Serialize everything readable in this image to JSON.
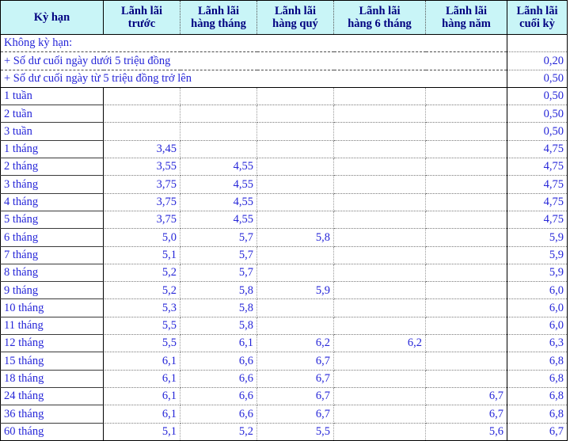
{
  "table": {
    "headers": [
      {
        "id": "term",
        "label": "Kỳ hạn",
        "name": "column-header-term"
      },
      {
        "id": "truoc",
        "label": "Lãnh lãi\ntrước",
        "name": "column-header-lanh-lai-truoc"
      },
      {
        "id": "thang",
        "label": "Lãnh lãi\nhàng tháng",
        "name": "column-header-lanh-lai-hang-thang"
      },
      {
        "id": "quy",
        "label": "Lãnh lãi\nhàng quý",
        "name": "column-header-lanh-lai-hang-quy"
      },
      {
        "id": "sau",
        "label": "Lãnh lãi\nhàng 6 tháng",
        "name": "column-header-lanh-lai-hang-6-thang"
      },
      {
        "id": "nam",
        "label": "Lãnh lãi\nhàng năm",
        "name": "column-header-lanh-lai-hang-nam"
      },
      {
        "id": "cuoi",
        "label": "Lãnh lãi\ncuối kỳ",
        "name": "column-header-lanh-lai-cuoi-ky"
      }
    ],
    "group_rows": [
      {
        "label": "Không kỳ hạn:",
        "cuoi": ""
      },
      {
        "label": "+ Số dư cuối ngày dưới 5 triệu đồng",
        "cuoi": "0,20"
      },
      {
        "label": "+ Số dư cuối ngày từ 5 triệu đồng trở lên",
        "cuoi": "0,50"
      }
    ],
    "rows": [
      {
        "term": "1 tuần",
        "truoc": "",
        "thang": "",
        "quy": "",
        "sau": "",
        "nam": "",
        "cuoi": "0,50"
      },
      {
        "term": "2 tuần",
        "truoc": "",
        "thang": "",
        "quy": "",
        "sau": "",
        "nam": "",
        "cuoi": "0,50"
      },
      {
        "term": "3 tuần",
        "truoc": "",
        "thang": "",
        "quy": "",
        "sau": "",
        "nam": "",
        "cuoi": "0,50"
      },
      {
        "term": "1 tháng",
        "truoc": "3,45",
        "thang": "",
        "quy": "",
        "sau": "",
        "nam": "",
        "cuoi": "4,75"
      },
      {
        "term": "2 tháng",
        "truoc": "3,55",
        "thang": "4,55",
        "quy": "",
        "sau": "",
        "nam": "",
        "cuoi": "4,75"
      },
      {
        "term": "3 tháng",
        "truoc": "3,75",
        "thang": "4,55",
        "quy": "",
        "sau": "",
        "nam": "",
        "cuoi": "4,75"
      },
      {
        "term": "4 tháng",
        "truoc": "3,75",
        "thang": "4,55",
        "quy": "",
        "sau": "",
        "nam": "",
        "cuoi": "4,75"
      },
      {
        "term": "5 tháng",
        "truoc": "3,75",
        "thang": "4,55",
        "quy": "",
        "sau": "",
        "nam": "",
        "cuoi": "4,75"
      },
      {
        "term": "6 tháng",
        "truoc": "5,0",
        "thang": "5,7",
        "quy": "5,8",
        "sau": "",
        "nam": "",
        "cuoi": "5,9"
      },
      {
        "term": "7 tháng",
        "truoc": "5,1",
        "thang": "5,7",
        "quy": "",
        "sau": "",
        "nam": "",
        "cuoi": "5,9"
      },
      {
        "term": "8 tháng",
        "truoc": "5,2",
        "thang": "5,7",
        "quy": "",
        "sau": "",
        "nam": "",
        "cuoi": "5,9"
      },
      {
        "term": "9 tháng",
        "truoc": "5,2",
        "thang": "5,8",
        "quy": "5,9",
        "sau": "",
        "nam": "",
        "cuoi": "6,0"
      },
      {
        "term": "10 tháng",
        "truoc": "5,3",
        "thang": "5,8",
        "quy": "",
        "sau": "",
        "nam": "",
        "cuoi": "6,0"
      },
      {
        "term": "11 tháng",
        "truoc": "5,5",
        "thang": "5,8",
        "quy": "",
        "sau": "",
        "nam": "",
        "cuoi": "6,0"
      },
      {
        "term": "12 tháng",
        "truoc": "5,5",
        "thang": "6,1",
        "quy": "6,2",
        "sau": "6,2",
        "nam": "",
        "cuoi": "6,3"
      },
      {
        "term": "15 tháng",
        "truoc": "6,1",
        "thang": "6,6",
        "quy": "6,7",
        "sau": "",
        "nam": "",
        "cuoi": "6,8"
      },
      {
        "term": "18 tháng",
        "truoc": "6,1",
        "thang": "6,6",
        "quy": "6,7",
        "sau": "",
        "nam": "",
        "cuoi": "6,8"
      },
      {
        "term": "24 tháng",
        "truoc": "6,1",
        "thang": "6,6",
        "quy": "6,7",
        "sau": "",
        "nam": "6,7",
        "cuoi": "6,8"
      },
      {
        "term": "36 tháng",
        "truoc": "6,1",
        "thang": "6,6",
        "quy": "6,7",
        "sau": "",
        "nam": "6,7",
        "cuoi": "6,8"
      },
      {
        "term": "60 tháng",
        "truoc": "5,1",
        "thang": "5,2",
        "quy": "5,5",
        "sau": "",
        "nam": "5,6",
        "cuoi": "6,7"
      }
    ]
  },
  "colors": {
    "header_background": "#c9f5f7",
    "header_text": "#000080",
    "value_text": "#2626d8",
    "border": "#000000",
    "page_background": "#ffffff"
  }
}
